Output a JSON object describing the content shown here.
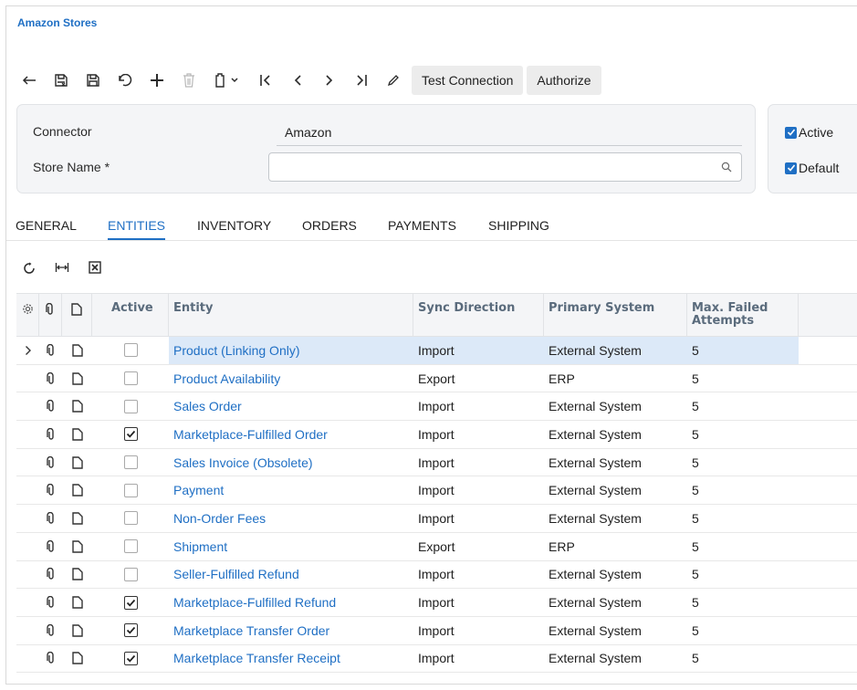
{
  "page": {
    "title": "Amazon Stores"
  },
  "toolbar": {
    "icons": [
      "back-arrow-icon",
      "save-close-icon",
      "save-icon",
      "undo-icon",
      "add-icon",
      "delete-icon",
      "copy-paste-icon",
      "first-record-icon",
      "previous-record-icon",
      "next-record-icon",
      "last-record-icon",
      "edit-icon"
    ],
    "test_connection_label": "Test Connection",
    "authorize_label": "Authorize"
  },
  "form": {
    "connector_label": "Connector",
    "connector_value": "Amazon",
    "store_name_label": "Store Name",
    "store_name_required_mark": "*",
    "store_name_value": "",
    "active_label": "Active",
    "active_checked": true,
    "default_label": "Default",
    "default_checked": true
  },
  "tabs": [
    {
      "label": "GENERAL",
      "active": false
    },
    {
      "label": "ENTITIES",
      "active": true
    },
    {
      "label": "INVENTORY",
      "active": false
    },
    {
      "label": "ORDERS",
      "active": false
    },
    {
      "label": "PAYMENTS",
      "active": false
    },
    {
      "label": "SHIPPING",
      "active": false
    }
  ],
  "grid_toolbar": {
    "icons": [
      "refresh-icon",
      "fit-columns-icon",
      "export-excel-icon"
    ]
  },
  "grid": {
    "columns": {
      "settings": "settings-icon",
      "files": "attachment-icon",
      "notes": "note-icon",
      "active": "Active",
      "entity": "Entity",
      "sync_direction": "Sync Direction",
      "primary_system": "Primary System",
      "max_failed_attempts": "Max. Failed Attempts"
    },
    "rows": [
      {
        "active": false,
        "entity": "Product (Linking Only)",
        "sync_direction": "Import",
        "primary_system": "External System",
        "max_failed": "5",
        "selected": true
      },
      {
        "active": false,
        "entity": "Product Availability",
        "sync_direction": "Export",
        "primary_system": "ERP",
        "max_failed": "5"
      },
      {
        "active": false,
        "entity": "Sales Order",
        "sync_direction": "Import",
        "primary_system": "External System",
        "max_failed": "5"
      },
      {
        "active": true,
        "entity": "Marketplace-Fulfilled Order",
        "sync_direction": "Import",
        "primary_system": "External System",
        "max_failed": "5"
      },
      {
        "active": false,
        "entity": "Sales Invoice (Obsolete)",
        "sync_direction": "Import",
        "primary_system": "External System",
        "max_failed": "5"
      },
      {
        "active": false,
        "entity": "Payment",
        "sync_direction": "Import",
        "primary_system": "External System",
        "max_failed": "5"
      },
      {
        "active": false,
        "entity": "Non-Order Fees",
        "sync_direction": "Import",
        "primary_system": "External System",
        "max_failed": "5"
      },
      {
        "active": false,
        "entity": "Shipment",
        "sync_direction": "Export",
        "primary_system": "ERP",
        "max_failed": "5"
      },
      {
        "active": false,
        "entity": "Seller-Fulfilled Refund",
        "sync_direction": "Import",
        "primary_system": "External System",
        "max_failed": "5"
      },
      {
        "active": true,
        "entity": "Marketplace-Fulfilled Refund",
        "sync_direction": "Import",
        "primary_system": "External System",
        "max_failed": "5"
      },
      {
        "active": true,
        "entity": "Marketplace Transfer Order",
        "sync_direction": "Import",
        "primary_system": "External System",
        "max_failed": "5"
      },
      {
        "active": true,
        "entity": "Marketplace Transfer Receipt",
        "sync_direction": "Import",
        "primary_system": "External System",
        "max_failed": "5"
      }
    ]
  },
  "colors": {
    "accent": "#1f6fc4",
    "selected_row": "#dce9f8",
    "header_bg": "#f4f5f7"
  }
}
